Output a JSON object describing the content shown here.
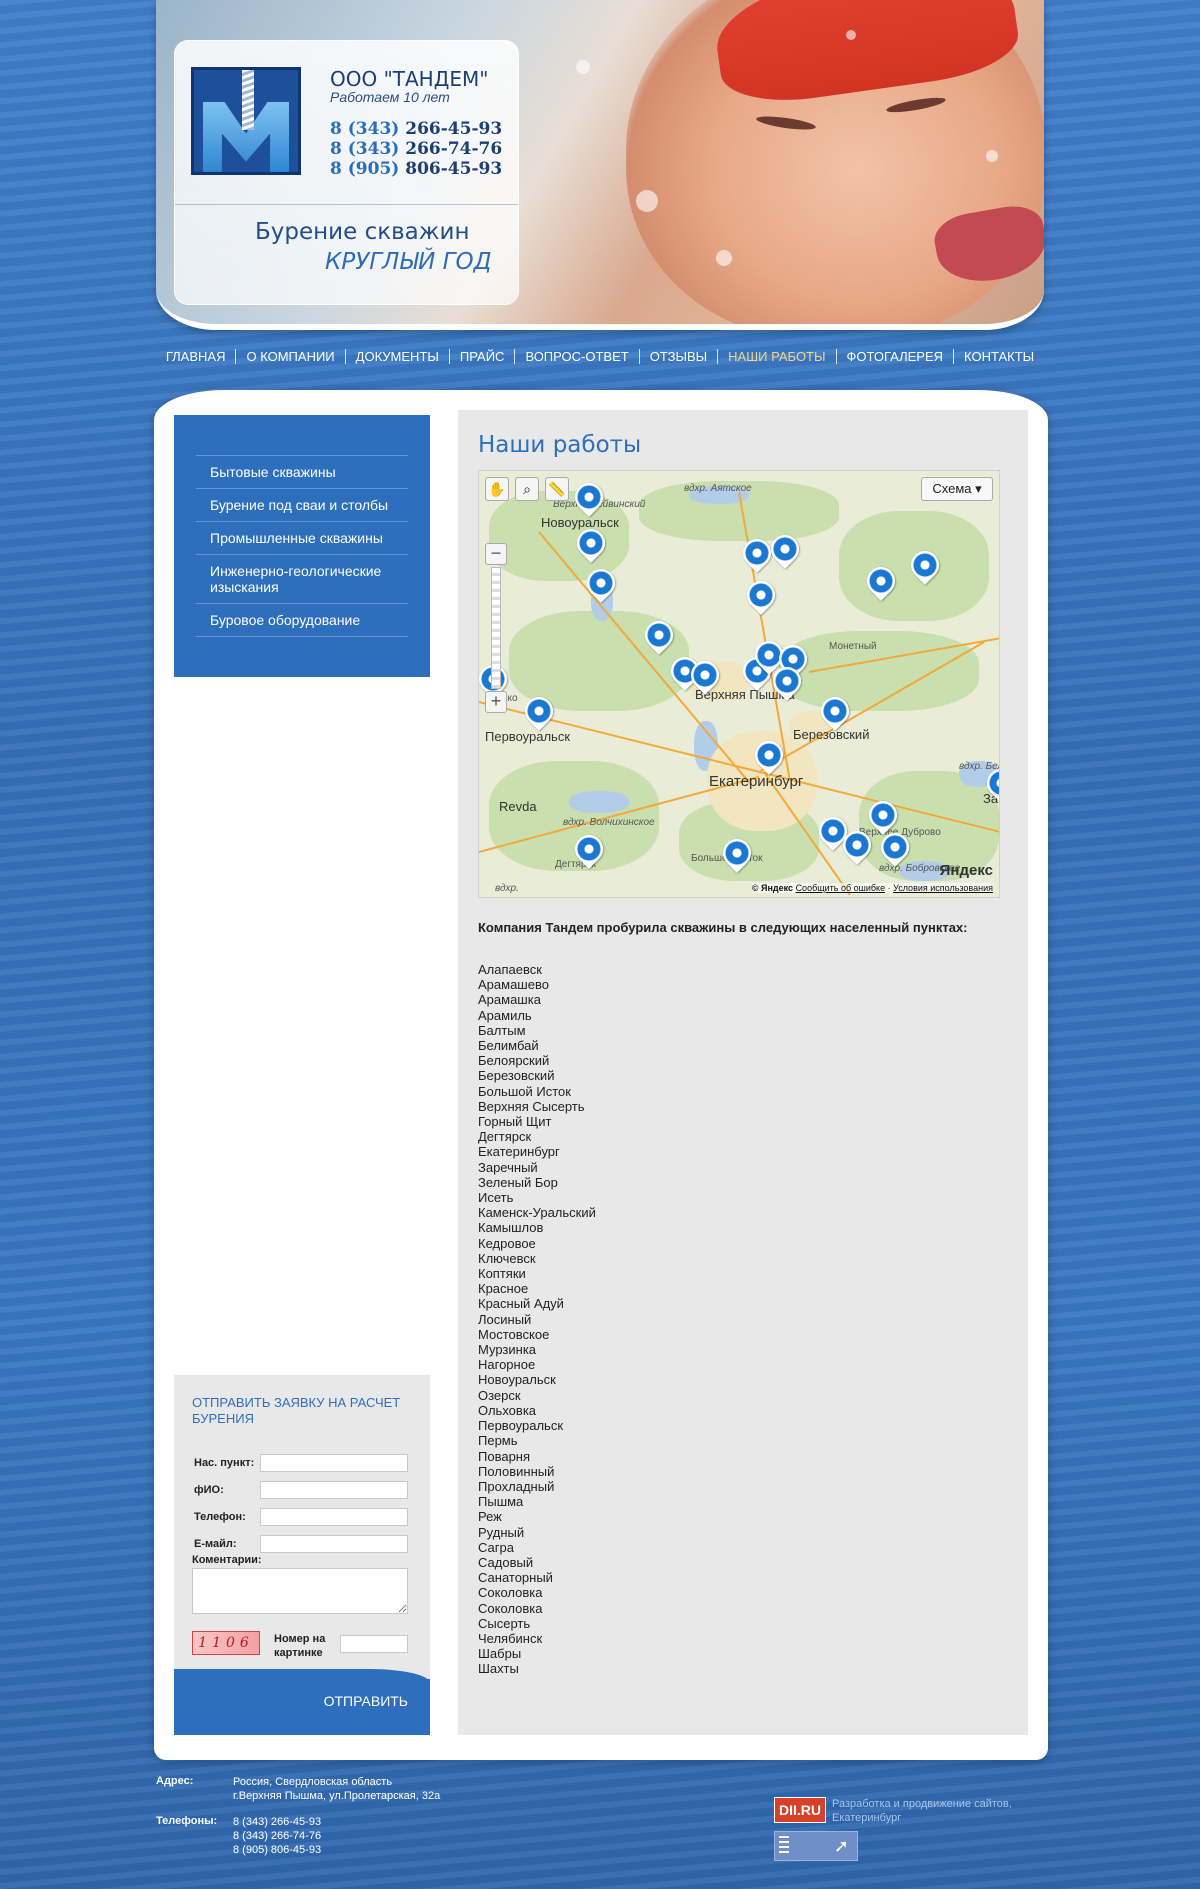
{
  "header": {
    "company_name": "ООО \"ТАНДЕМ\"",
    "company_sub": "Работаем 10 лет",
    "phones": [
      {
        "code": "8 (343)",
        "number": "266-45-93"
      },
      {
        "code": "8 (343)",
        "number": "266-74-76"
      },
      {
        "code": "8 (905)",
        "number": "806-45-93"
      }
    ],
    "slogan_line1": "Бурение скважин",
    "slogan_line2": "КРУГЛЫЙ ГОД"
  },
  "nav": {
    "items": [
      "ГЛАВНАЯ",
      "О КОМПАНИИ",
      "ДОКУМЕНТЫ",
      "ПРАЙС",
      "ВОПРОС-ОТВЕТ",
      "ОТЗЫВЫ",
      "НАШИ РАБОТЫ",
      "ФОТОГАЛЕРЕЯ",
      "КОНТАКТЫ"
    ],
    "active": "НАШИ РАБОТЫ"
  },
  "sidebar": {
    "items": [
      "Бытовые скважины",
      "Бурение под сваи и столбы",
      "Промышленные скважины",
      "Инженерно-геологические изыскания",
      "Буровое оборудование"
    ]
  },
  "form": {
    "title": "ОТПРАВИТЬ ЗАЯВКУ НА РАСЧЕТ БУРЕНИЯ",
    "field_city": "Нас. пункт:",
    "field_name": "фИО:",
    "field_phone": "Телефон:",
    "field_email": "Е-майл:",
    "field_comment": "Коментарии:",
    "captcha_text": "1106",
    "captcha_label": "Номер на картинке",
    "submit": "ОТПРАВИТЬ"
  },
  "content": {
    "title": "Наши работы",
    "map": {
      "scheme_button": "Схема ▾",
      "yandex_logo": "Яндекс",
      "footer_copy": "© Яндекс",
      "footer_report": "Сообщить об ошибке",
      "footer_terms": "Условия использования",
      "labels": {
        "novouralsk": "Новоуральск",
        "verkhny": "Верхне-Нейвинский",
        "aytskoe": "вдхр. Аятское",
        "monetny": "Монетный",
        "verkhnyaya_pyshma": "Верхняя Пышма",
        "pervouralsk": "Первоуральск",
        "berezovsky": "Березовский",
        "ekaterinburg": "Екатеринбург",
        "revda": "Revda",
        "volchikhinskoe": "вдхр. Волчихинское",
        "degtyarsk": "Дегтярск",
        "bolshoy_istok": "Большой Исток",
        "verkhnie_dubrovo": "Верхнее Дуброво",
        "beloyarskoe": "вдхр. Белоярское",
        "bobrovskoe": "вдхр. Бобровское",
        "vdkhr": "вдхр.",
        "zar": "Зар",
        "nsko": "...вско"
      }
    },
    "list_heading": "Компания Тандем пробурила скважины в следующих населенный пунктах:",
    "cities": [
      "Алапаевск",
      "Арамашево",
      "Арамашка",
      "Арамиль",
      "Балтым",
      "Белимбай",
      "Белоярский",
      "Березовский",
      "Большой Исток",
      "Верхняя Сысерть",
      "Горный Щит",
      "Дегтярск",
      "Екатеринбург",
      "Заречный",
      "Зеленый Бор",
      "Исеть",
      "Каменск-Уральский",
      "Камышлов",
      "Кедровое",
      "Ключевск",
      "Коптяки",
      "Красное",
      "Красный Адуй",
      "Лосиный",
      "Мостовское",
      "Мурзинка",
      "Нагорное",
      "Новоуральск",
      "Озерск",
      "Ольховка",
      "Первоуральск",
      "Пермь",
      "Поварня",
      "Половинный",
      "Прохладный",
      "Пышма",
      "Реж",
      "Рудный",
      "Сагра",
      "Садовый",
      "Санаторный",
      "Соколовка",
      "Соколовка",
      "Сысерть",
      "Челябинск",
      "Шабры",
      "Шахты"
    ]
  },
  "footer": {
    "address_label": "Адрес:",
    "address_line1": "Россия, Свердловская область",
    "address_line2": "г.Верхняя Пышма, ул.Пролетарская, 32а",
    "phones_label": "Телефоны:",
    "phones": [
      "8 (343) 266-45-93",
      "8 (343) 266-74-76",
      "8 (905) 806-45-93"
    ],
    "dev_logo": "DII.RU",
    "dev_text": "Разработка и продвижение сайтов, Екатеринбург"
  },
  "colors": {
    "accent": "#2d6fbd",
    "nav_active": "#f4d58b",
    "background": "#3b78c2"
  }
}
